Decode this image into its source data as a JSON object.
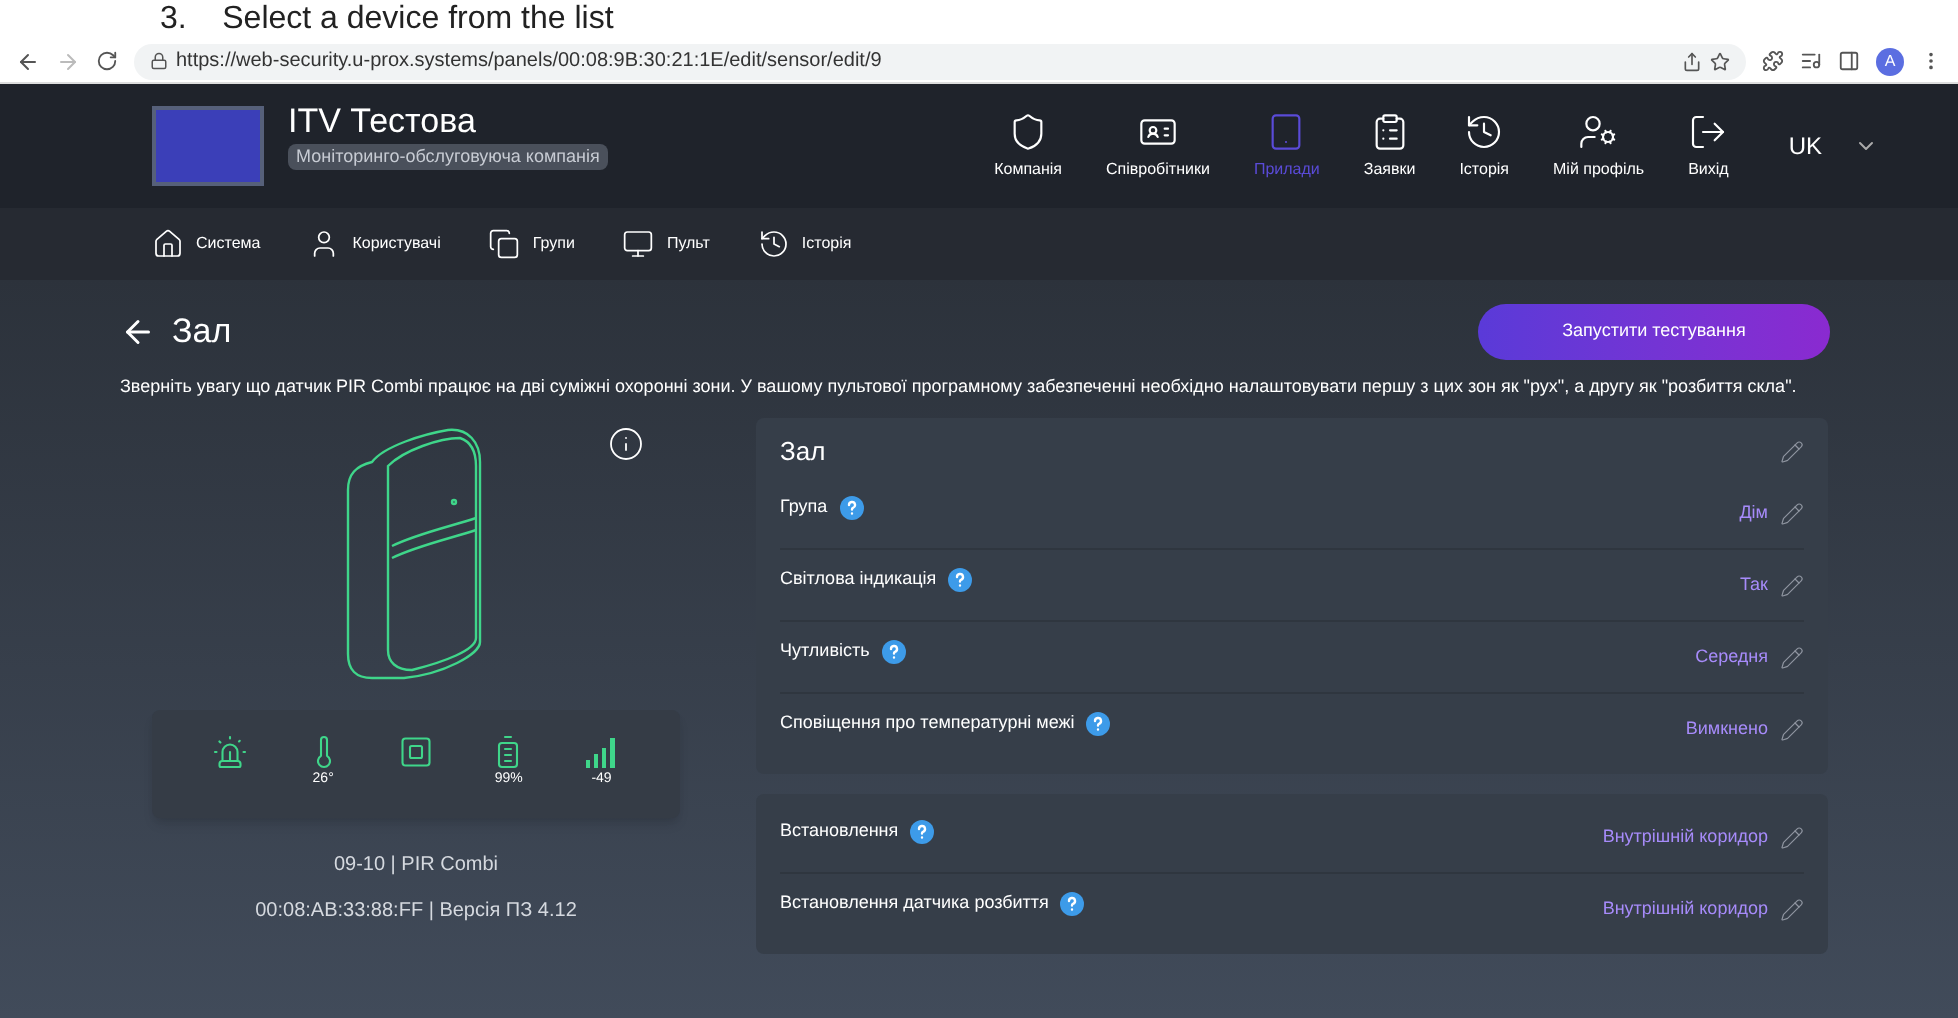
{
  "caption": "3.    Select a device from the list",
  "browser": {
    "url": "https://web-security.u-prox.systems/panels/00:08:9B:30:21:1E/edit/sensor/edit/9",
    "profile_initial": "A"
  },
  "header": {
    "company_name": "ITV Тестова",
    "company_type": "Моніторинго-обслуговуюча компанія",
    "nav": [
      {
        "kind": "shield",
        "label": "Компанія",
        "selected": false
      },
      {
        "kind": "idcard",
        "label": "Співробітники",
        "selected": false
      },
      {
        "kind": "tablet",
        "label": "Прилади",
        "selected": true
      },
      {
        "kind": "clipboard",
        "label": "Заявки",
        "selected": false
      },
      {
        "kind": "history",
        "label": "Історія",
        "selected": false
      },
      {
        "kind": "usergear",
        "label": "Мій профіль",
        "selected": false
      },
      {
        "kind": "logout",
        "label": "Вихід",
        "selected": false
      }
    ],
    "language": "UK"
  },
  "subnav": [
    {
      "kind": "home",
      "label": "Система"
    },
    {
      "kind": "user",
      "label": "Користувачі"
    },
    {
      "kind": "copy",
      "label": "Групи"
    },
    {
      "kind": "monitor",
      "label": "Пульт"
    },
    {
      "kind": "history",
      "label": "Історія"
    }
  ],
  "page": {
    "title": "Зал",
    "action_button": "Запустити тестування",
    "notice": "Зверніть увагу що датчик PIR Combi працює на дві суміжні охоронні зони. У вашому пультової програмному забезпеченні необхідно налаштовувати першу з цих зон як \"рух\", а другу як \"розбиття скла\"."
  },
  "device": {
    "status": [
      {
        "kind": "siren"
      },
      {
        "kind": "thermometer",
        "reading": "26°"
      },
      {
        "kind": "tamper"
      },
      {
        "kind": "battery",
        "reading": "99%"
      },
      {
        "kind": "signal",
        "reading": "-49"
      }
    ],
    "name_line": "09-10 | PIR Combi",
    "mac_line": "00:08:AB:33:88:FF | Версія ПЗ 4.12"
  },
  "settings_cards": [
    {
      "title": "Зал",
      "rows": [
        {
          "label": "Група",
          "value": "Дім"
        },
        {
          "label": "Світлова індикація",
          "value": "Так"
        },
        {
          "label": "Чутливість",
          "value": "Середня"
        },
        {
          "label": "Сповіщення про температурні межі",
          "value": "Вимкнено"
        }
      ]
    },
    {
      "rows": [
        {
          "label": "Встановлення",
          "value": "Внутрішній коридор"
        },
        {
          "label": "Встановлення датчика розбиття",
          "value": "Внутрішній коридор"
        }
      ]
    }
  ]
}
